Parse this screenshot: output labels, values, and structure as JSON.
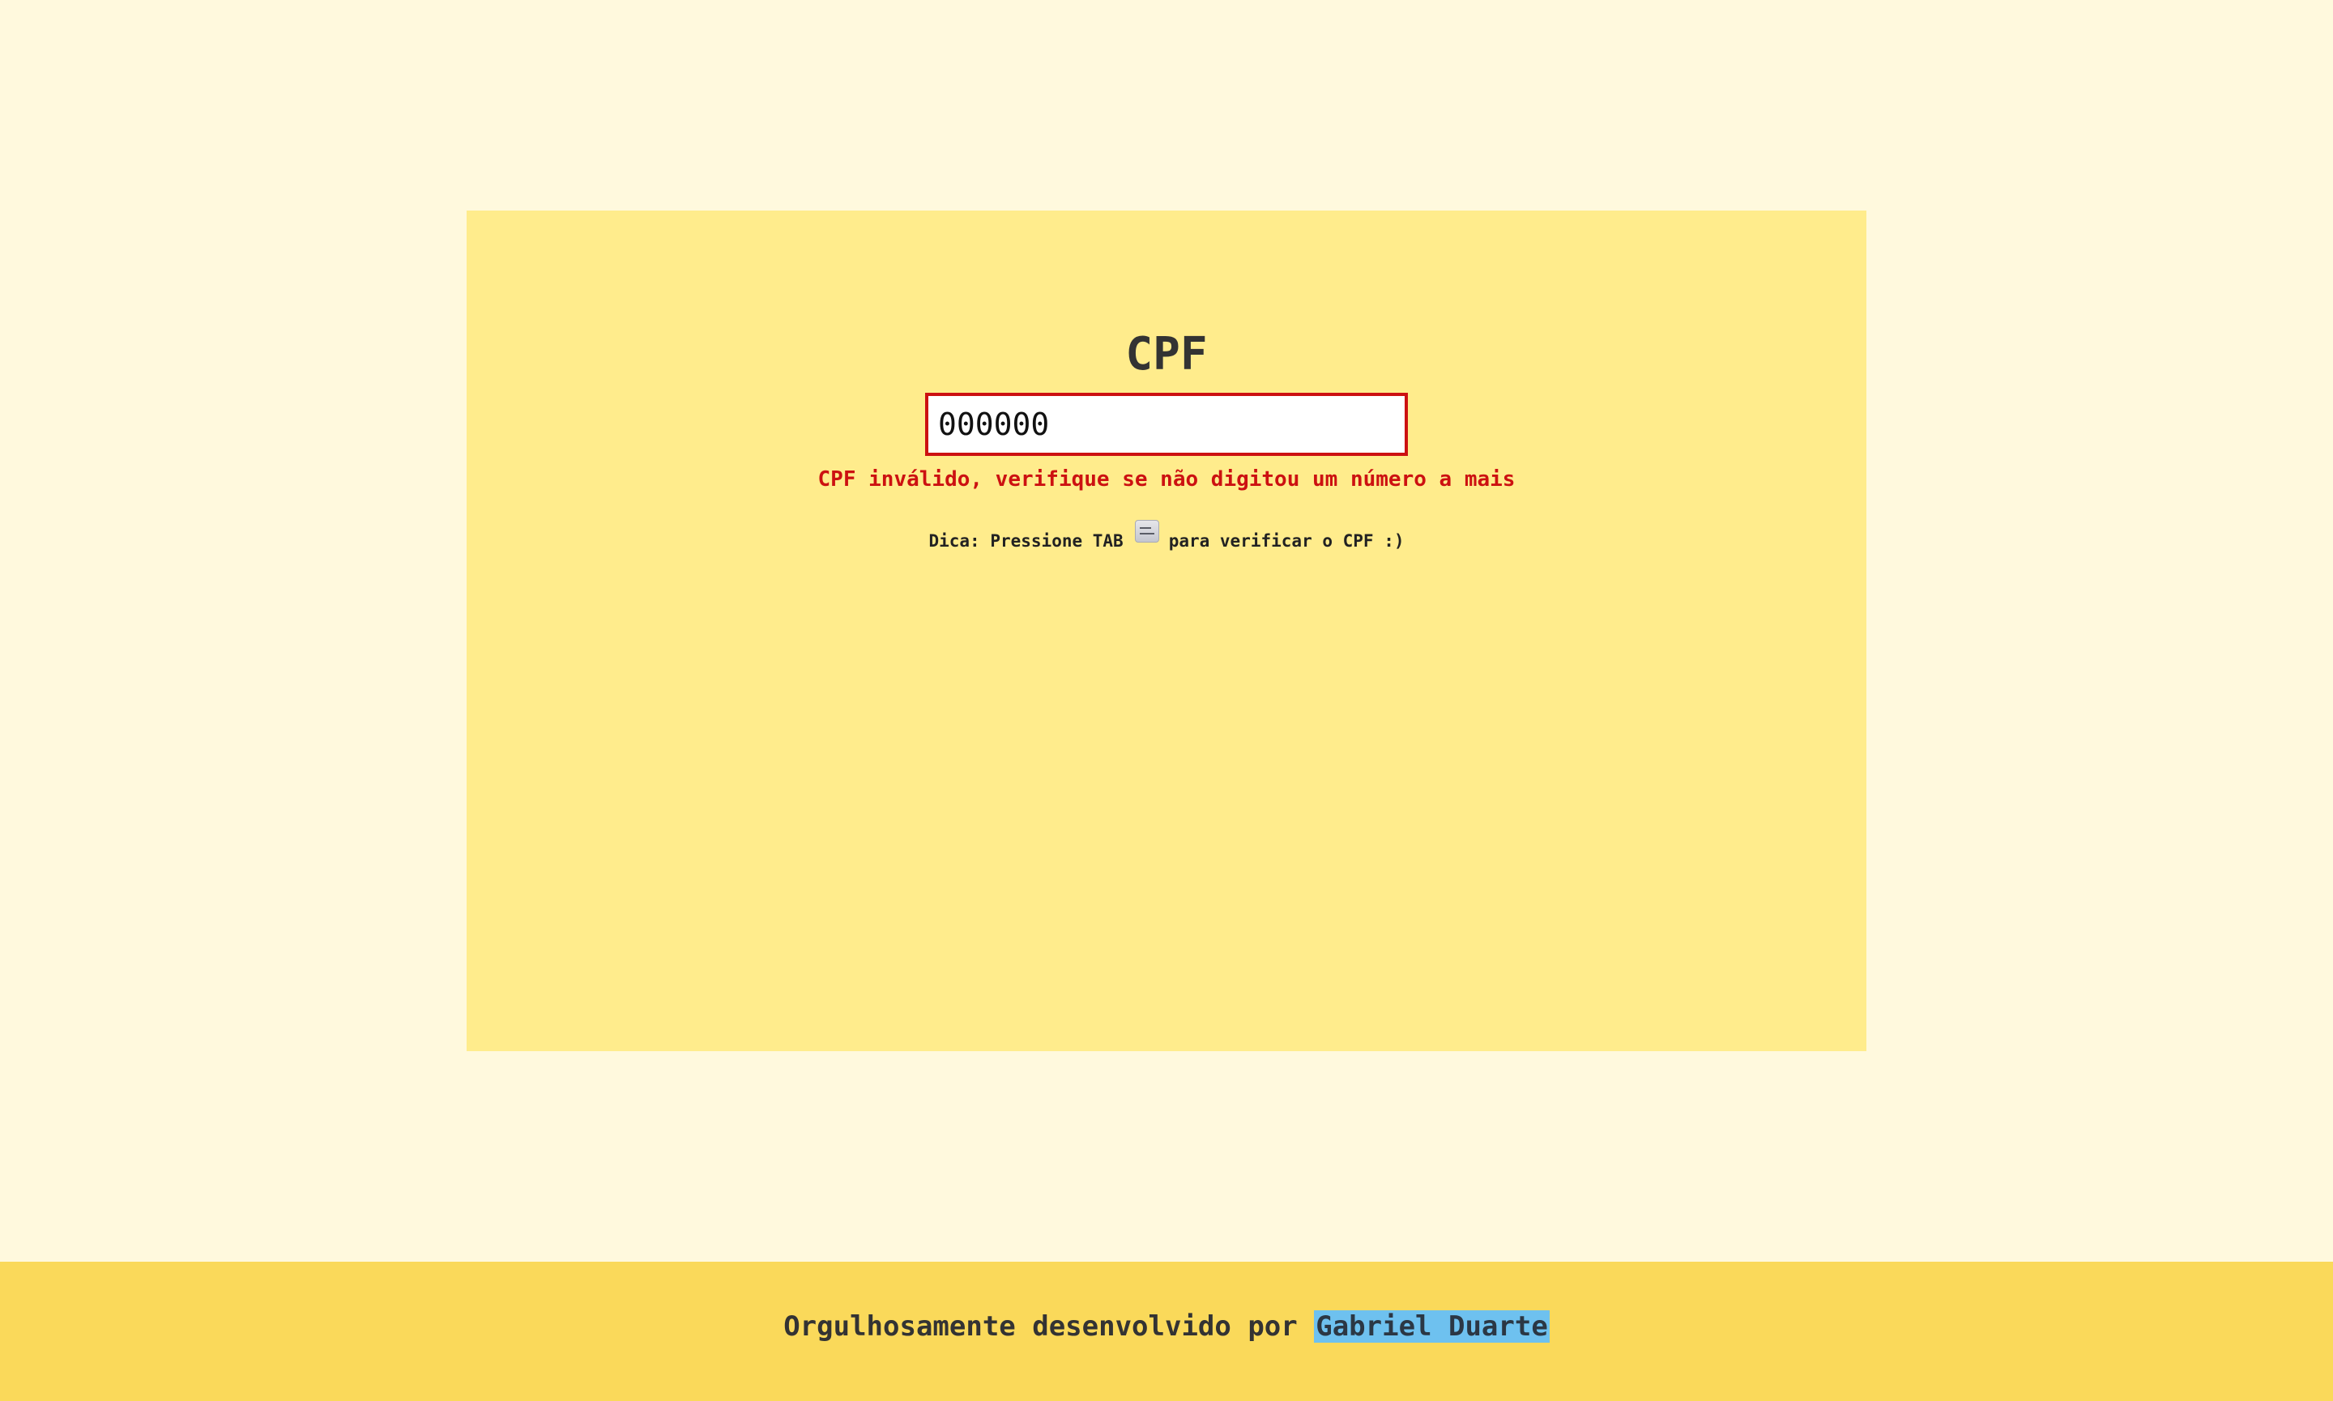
{
  "form": {
    "title": "CPF",
    "input_value": "000000",
    "error_message": "CPF inválido, verifique se não digitou um número a mais",
    "tip_before": "Dica: Pressione TAB",
    "tip_key_icon": "tab-key-icon",
    "tip_after": "para verificar o CPF :)"
  },
  "footer": {
    "text": "Orgulhosamente desenvolvido por",
    "author": "Gabriel Duarte"
  },
  "colors": {
    "page_background": "#fff9dd",
    "card_background": "#ffec8c",
    "footer_background": "#fad95a",
    "error": "#cc1111",
    "highlight": "#6ec1ef"
  }
}
